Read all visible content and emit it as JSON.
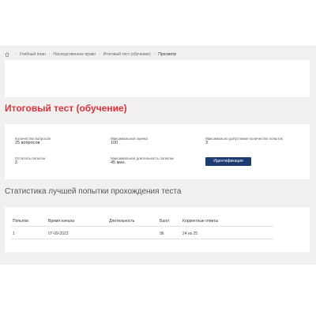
{
  "breadcrumb": {
    "items": [
      "Учебный план",
      "Наследственное право",
      "Итоговый тест (обучение)",
      "Просмотр"
    ]
  },
  "page_title": "Итоговый тест (обучение)",
  "info": {
    "questions_label": "Количество вопросов",
    "questions_value": "25 вопросов",
    "max_score_label": "Максимальная оценка",
    "max_score_value": "100",
    "max_attempts_label": "Максимально допустимое количество попыток",
    "max_attempts_value": "3",
    "attempts_left_label": "Осталось попыток",
    "attempts_left_value": "2",
    "max_duration_label": "Максимальная длительность попытки",
    "max_duration_value": "45 мин.",
    "identify_button": "Идентификация"
  },
  "stats": {
    "title": "Статистика лучшей попытки прохождения теста",
    "columns": [
      "Попытки",
      "Время начала",
      "Длительность",
      "Балл",
      "Корректные ответы"
    ],
    "rows": [
      [
        "1",
        "07-09-2023",
        "",
        "96",
        "24 из 25"
      ]
    ]
  },
  "colors": {
    "title": "#e0303a",
    "button": "#1d3d70",
    "background": "#f2f0ee"
  }
}
